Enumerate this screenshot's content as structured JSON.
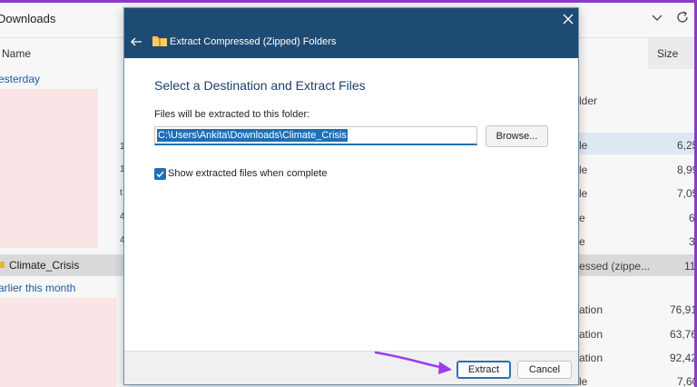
{
  "explorer": {
    "title": "Downloads",
    "column_name": "Name",
    "column_size": "Size",
    "groups": [
      "esterday",
      "arlier this month"
    ],
    "selected_row_name": "Climate_Crisis",
    "right_column": [
      {
        "type": "lder",
        "size": ""
      },
      {
        "type": "le",
        "size": "6,25"
      },
      {
        "type": "le",
        "size": "8,99"
      },
      {
        "type": "le",
        "size": "7,05"
      },
      {
        "type": "e",
        "size": "6"
      },
      {
        "type": "e",
        "size": "3"
      },
      {
        "type": "essed (zippe...",
        "size": "11"
      },
      {
        "type": "ation",
        "size": "76,91"
      },
      {
        "type": "ation",
        "size": "63,76"
      },
      {
        "type": "ation",
        "size": "92,42"
      },
      {
        "type": "le",
        "size": "7,60"
      }
    ],
    "left_stubs": [
      "1",
      "1",
      "t",
      "4",
      "4"
    ]
  },
  "dialog": {
    "title": "Extract Compressed (Zipped) Folders",
    "heading": "Select a Destination and Extract Files",
    "field_label": "Files will be extracted to this folder:",
    "path_value": "C:\\Users\\Ankita\\Downloads\\Climate_Crisis",
    "browse_label": "Browse...",
    "checkbox_label": "Show extracted files when complete",
    "checkbox_checked": true,
    "extract_label": "Extract",
    "cancel_label": "Cancel"
  },
  "colors": {
    "titlebar": "#1e4b73",
    "accent": "#1f6fb5",
    "arrow": "#9b3df0"
  }
}
